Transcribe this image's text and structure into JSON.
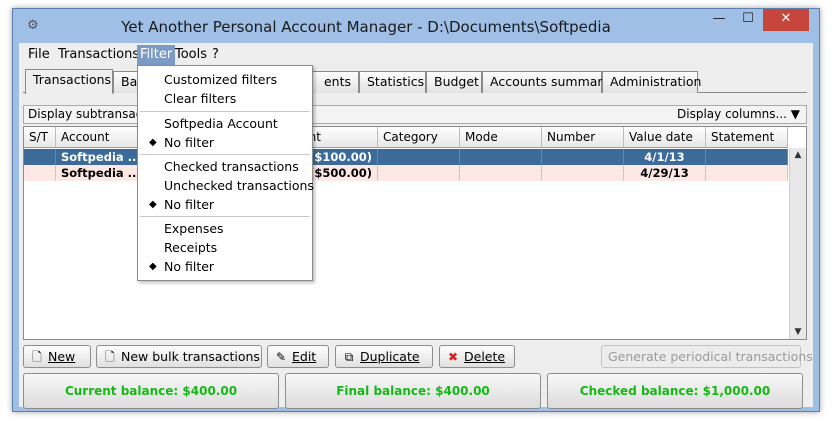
{
  "window": {
    "title": "Yet Another Personal Account Manager - D:\\Documents\\Softpedia",
    "min_glyph": "—",
    "max_glyph": "☐",
    "close_glyph": "✕"
  },
  "menubar": {
    "items": [
      "File",
      "Transactions",
      "Filter",
      "Tools",
      "?"
    ]
  },
  "tabs": [
    "Transactions",
    "Ba",
    "ents",
    "Statistics",
    "Budget",
    "Accounts summary",
    "Administration"
  ],
  "subbar": {
    "left": "Display subtransact",
    "right": "Display columns...",
    "right_icon": "▼"
  },
  "table": {
    "columns": [
      "S/T",
      "Account",
      "Amount",
      "Category",
      "Mode",
      "Number",
      "Value date",
      "Statement"
    ],
    "amount_header_visible": "mount",
    "rows": [
      {
        "account": "Softpedia ...",
        "amount": "($100.00)",
        "value_date": "4/1/13",
        "selected": true
      },
      {
        "account": "Softpedia ...",
        "amount": "($500.00)",
        "value_date": "4/29/13",
        "selected": false
      }
    ]
  },
  "filter_menu": {
    "items": [
      {
        "label": "Customized filters",
        "checked": false
      },
      {
        "label": "Clear filters",
        "checked": false
      },
      {
        "sep": true
      },
      {
        "label": "Softpedia Account",
        "checked": false
      },
      {
        "label": "No filter",
        "checked": true
      },
      {
        "sep": true
      },
      {
        "label": "Checked transactions",
        "checked": false
      },
      {
        "label": "Unchecked transactions",
        "checked": false
      },
      {
        "label": "No filter",
        "checked": true
      },
      {
        "sep": true
      },
      {
        "label": "Expenses",
        "checked": false
      },
      {
        "label": "Receipts",
        "checked": false
      },
      {
        "label": "No filter",
        "checked": true
      }
    ],
    "check_glyph": "◆"
  },
  "buttons": {
    "new": "New",
    "new_bulk": "New bulk transactions",
    "edit": "Edit",
    "duplicate": "Duplicate",
    "delete": "Delete",
    "generate": "Generate periodical transactions"
  },
  "balances": {
    "current": "Current balance: $400.00",
    "final": "Final balance: $400.00",
    "checked": "Checked balance: $1,000.00"
  },
  "colors": {
    "selected_row": "#3d6b99",
    "alt_row": "#fde8e6",
    "balance_text": "#16b816",
    "close_button": "#c7463c"
  }
}
